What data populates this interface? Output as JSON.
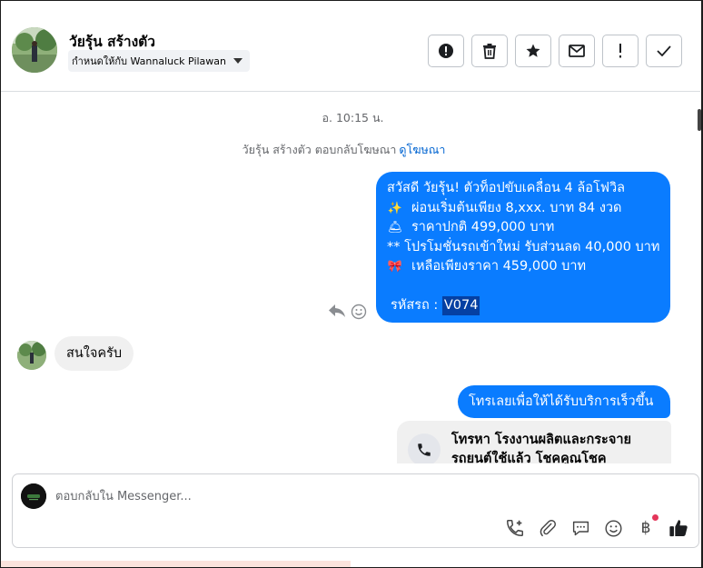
{
  "header": {
    "contact_name": "วัยรุ้น สร้างตัว",
    "assign_label": "กำหนดให้กับ Wannaluck Pilawan",
    "actions": [
      {
        "name": "alert-circle-icon"
      },
      {
        "name": "trash-icon"
      },
      {
        "name": "star-icon"
      },
      {
        "name": "envelope-icon"
      },
      {
        "name": "exclamation-icon"
      },
      {
        "name": "check-icon"
      }
    ]
  },
  "conversation": {
    "timestamp": "อ. 10:15 น.",
    "ad_reply_text": "วัยรุ้น สร้างตัว ตอบกลับโฆษณา",
    "ad_link": "ดูโฆษณา",
    "outgoing_1": {
      "line1": "สวัสดี วัยรุ้น! ตัวท็อปขับเคลื่อน 4 ล้อโฟวิล",
      "line2_emoji": "✨",
      "line2": "ผ่อนเริ่มต้นเพียง 8,xxx. บาท 84 งวด",
      "line3_emoji": "🛎",
      "line3": "ราคาปกติ 499,000 บาท",
      "line4": "** โปรโมชั่นรถเข้าใหม่ รับส่วนลด 40,000 บาท",
      "line5_emoji": "🎀",
      "line5": "เหลือเพียงราคา 459,000 บาท",
      "code_label": "รหัสรถ : ",
      "code_value": "V074"
    },
    "incoming_1": "สนใจครับ",
    "outgoing_2": "โทรเลยเพื่อให้ได้รับบริการเร็วขึ้น",
    "call_card": {
      "line1": "โทรหา โรงงานผลิตและกระจาย",
      "line2": "รถยนต์ใช้แล้ว โชคคูณโชค"
    }
  },
  "composer": {
    "placeholder": "ตอบกลับใน Messenger...",
    "baht_symbol": "฿"
  }
}
